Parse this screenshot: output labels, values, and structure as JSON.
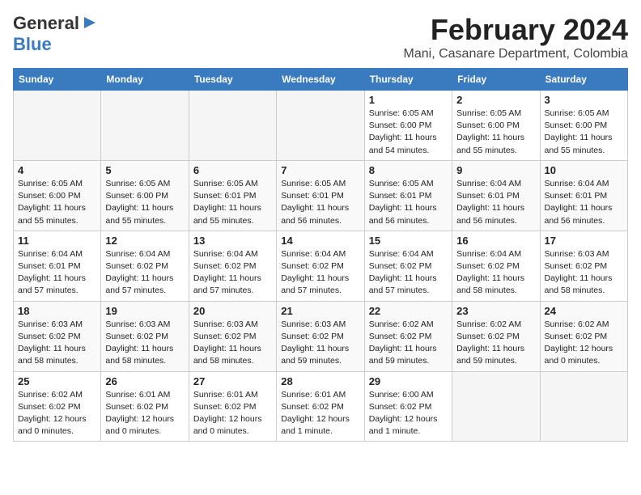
{
  "logo": {
    "general": "General",
    "blue": "Blue",
    "arrow_icon": "▶"
  },
  "title": {
    "month_year": "February 2024",
    "location": "Mani, Casanare Department, Colombia"
  },
  "weekdays": [
    "Sunday",
    "Monday",
    "Tuesday",
    "Wednesday",
    "Thursday",
    "Friday",
    "Saturday"
  ],
  "weeks": [
    [
      {
        "day": "",
        "detail": ""
      },
      {
        "day": "",
        "detail": ""
      },
      {
        "day": "",
        "detail": ""
      },
      {
        "day": "",
        "detail": ""
      },
      {
        "day": "1",
        "detail": "Sunrise: 6:05 AM\nSunset: 6:00 PM\nDaylight: 11 hours\nand 54 minutes."
      },
      {
        "day": "2",
        "detail": "Sunrise: 6:05 AM\nSunset: 6:00 PM\nDaylight: 11 hours\nand 55 minutes."
      },
      {
        "day": "3",
        "detail": "Sunrise: 6:05 AM\nSunset: 6:00 PM\nDaylight: 11 hours\nand 55 minutes."
      }
    ],
    [
      {
        "day": "4",
        "detail": "Sunrise: 6:05 AM\nSunset: 6:00 PM\nDaylight: 11 hours\nand 55 minutes."
      },
      {
        "day": "5",
        "detail": "Sunrise: 6:05 AM\nSunset: 6:00 PM\nDaylight: 11 hours\nand 55 minutes."
      },
      {
        "day": "6",
        "detail": "Sunrise: 6:05 AM\nSunset: 6:01 PM\nDaylight: 11 hours\nand 55 minutes."
      },
      {
        "day": "7",
        "detail": "Sunrise: 6:05 AM\nSunset: 6:01 PM\nDaylight: 11 hours\nand 56 minutes."
      },
      {
        "day": "8",
        "detail": "Sunrise: 6:05 AM\nSunset: 6:01 PM\nDaylight: 11 hours\nand 56 minutes."
      },
      {
        "day": "9",
        "detail": "Sunrise: 6:04 AM\nSunset: 6:01 PM\nDaylight: 11 hours\nand 56 minutes."
      },
      {
        "day": "10",
        "detail": "Sunrise: 6:04 AM\nSunset: 6:01 PM\nDaylight: 11 hours\nand 56 minutes."
      }
    ],
    [
      {
        "day": "11",
        "detail": "Sunrise: 6:04 AM\nSunset: 6:01 PM\nDaylight: 11 hours\nand 57 minutes."
      },
      {
        "day": "12",
        "detail": "Sunrise: 6:04 AM\nSunset: 6:02 PM\nDaylight: 11 hours\nand 57 minutes."
      },
      {
        "day": "13",
        "detail": "Sunrise: 6:04 AM\nSunset: 6:02 PM\nDaylight: 11 hours\nand 57 minutes."
      },
      {
        "day": "14",
        "detail": "Sunrise: 6:04 AM\nSunset: 6:02 PM\nDaylight: 11 hours\nand 57 minutes."
      },
      {
        "day": "15",
        "detail": "Sunrise: 6:04 AM\nSunset: 6:02 PM\nDaylight: 11 hours\nand 57 minutes."
      },
      {
        "day": "16",
        "detail": "Sunrise: 6:04 AM\nSunset: 6:02 PM\nDaylight: 11 hours\nand 58 minutes."
      },
      {
        "day": "17",
        "detail": "Sunrise: 6:03 AM\nSunset: 6:02 PM\nDaylight: 11 hours\nand 58 minutes."
      }
    ],
    [
      {
        "day": "18",
        "detail": "Sunrise: 6:03 AM\nSunset: 6:02 PM\nDaylight: 11 hours\nand 58 minutes."
      },
      {
        "day": "19",
        "detail": "Sunrise: 6:03 AM\nSunset: 6:02 PM\nDaylight: 11 hours\nand 58 minutes."
      },
      {
        "day": "20",
        "detail": "Sunrise: 6:03 AM\nSunset: 6:02 PM\nDaylight: 11 hours\nand 58 minutes."
      },
      {
        "day": "21",
        "detail": "Sunrise: 6:03 AM\nSunset: 6:02 PM\nDaylight: 11 hours\nand 59 minutes."
      },
      {
        "day": "22",
        "detail": "Sunrise: 6:02 AM\nSunset: 6:02 PM\nDaylight: 11 hours\nand 59 minutes."
      },
      {
        "day": "23",
        "detail": "Sunrise: 6:02 AM\nSunset: 6:02 PM\nDaylight: 11 hours\nand 59 minutes."
      },
      {
        "day": "24",
        "detail": "Sunrise: 6:02 AM\nSunset: 6:02 PM\nDaylight: 12 hours\nand 0 minutes."
      }
    ],
    [
      {
        "day": "25",
        "detail": "Sunrise: 6:02 AM\nSunset: 6:02 PM\nDaylight: 12 hours\nand 0 minutes."
      },
      {
        "day": "26",
        "detail": "Sunrise: 6:01 AM\nSunset: 6:02 PM\nDaylight: 12 hours\nand 0 minutes."
      },
      {
        "day": "27",
        "detail": "Sunrise: 6:01 AM\nSunset: 6:02 PM\nDaylight: 12 hours\nand 0 minutes."
      },
      {
        "day": "28",
        "detail": "Sunrise: 6:01 AM\nSunset: 6:02 PM\nDaylight: 12 hours\nand 1 minute."
      },
      {
        "day": "29",
        "detail": "Sunrise: 6:00 AM\nSunset: 6:02 PM\nDaylight: 12 hours\nand 1 minute."
      },
      {
        "day": "",
        "detail": ""
      },
      {
        "day": "",
        "detail": ""
      }
    ]
  ]
}
